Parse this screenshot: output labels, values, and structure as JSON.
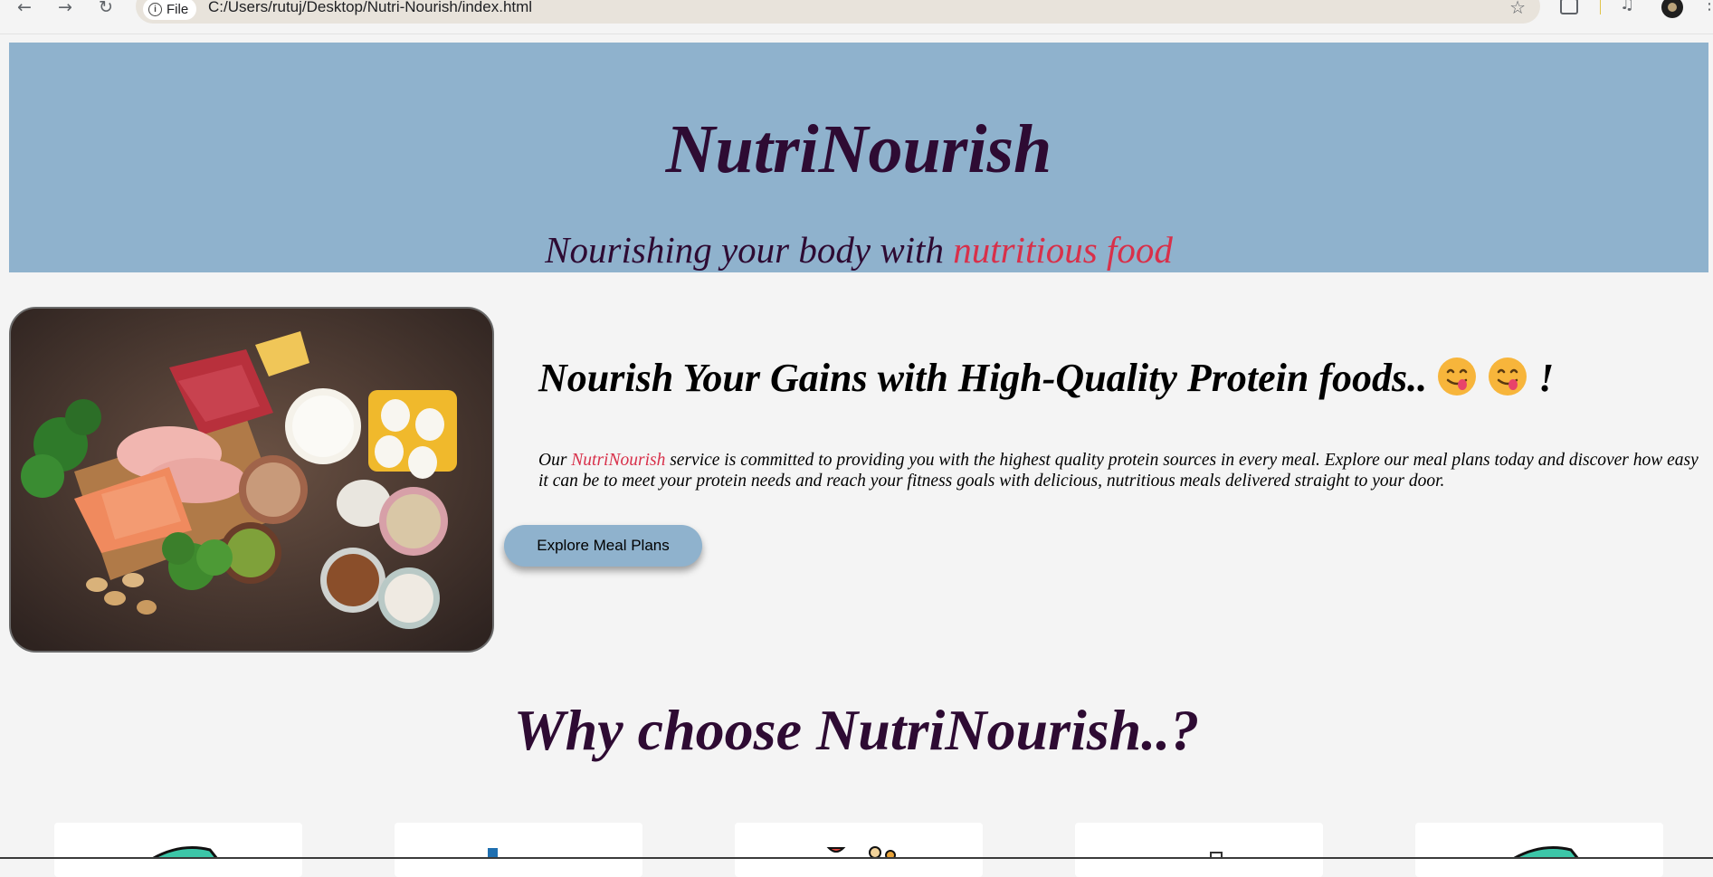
{
  "browser": {
    "site_chip_label": "File",
    "url": "C:/Users/rutuj/Desktop/Nutri-Nourish/index.html"
  },
  "header": {
    "title": "NutriNourish",
    "tagline_prefix": "Nourishing your body with ",
    "tagline_highlight": "nutritious food"
  },
  "intro": {
    "heading_text": "Nourish Your Gains with High-Quality Protein foods.. ",
    "heading_suffix": "!",
    "paragraph_prefix": "Our ",
    "paragraph_brand": "NutriNourish",
    "paragraph_rest": " service is committed to providing you with the highest quality protein sources in every meal. Explore our meal plans today and discover how easy it can be to meet your protein needs and reach your fitness goals with delicious, nutritious meals delivered straight to your door.",
    "cta_label": "Explore Meal Plans"
  },
  "why": {
    "heading": "Why choose NutriNourish..?"
  },
  "colors": {
    "banner": "#8fb2cd",
    "title": "#2e0b33",
    "accent": "#d8304a",
    "page_background": "#f4f4f4"
  },
  "icons": [
    "back-arrow-icon",
    "forward-arrow-icon",
    "reload-icon",
    "info-icon",
    "star-icon",
    "extensions-icon",
    "media-icon",
    "avatar",
    "menu-dots-icon",
    "yum-face-emoji"
  ]
}
